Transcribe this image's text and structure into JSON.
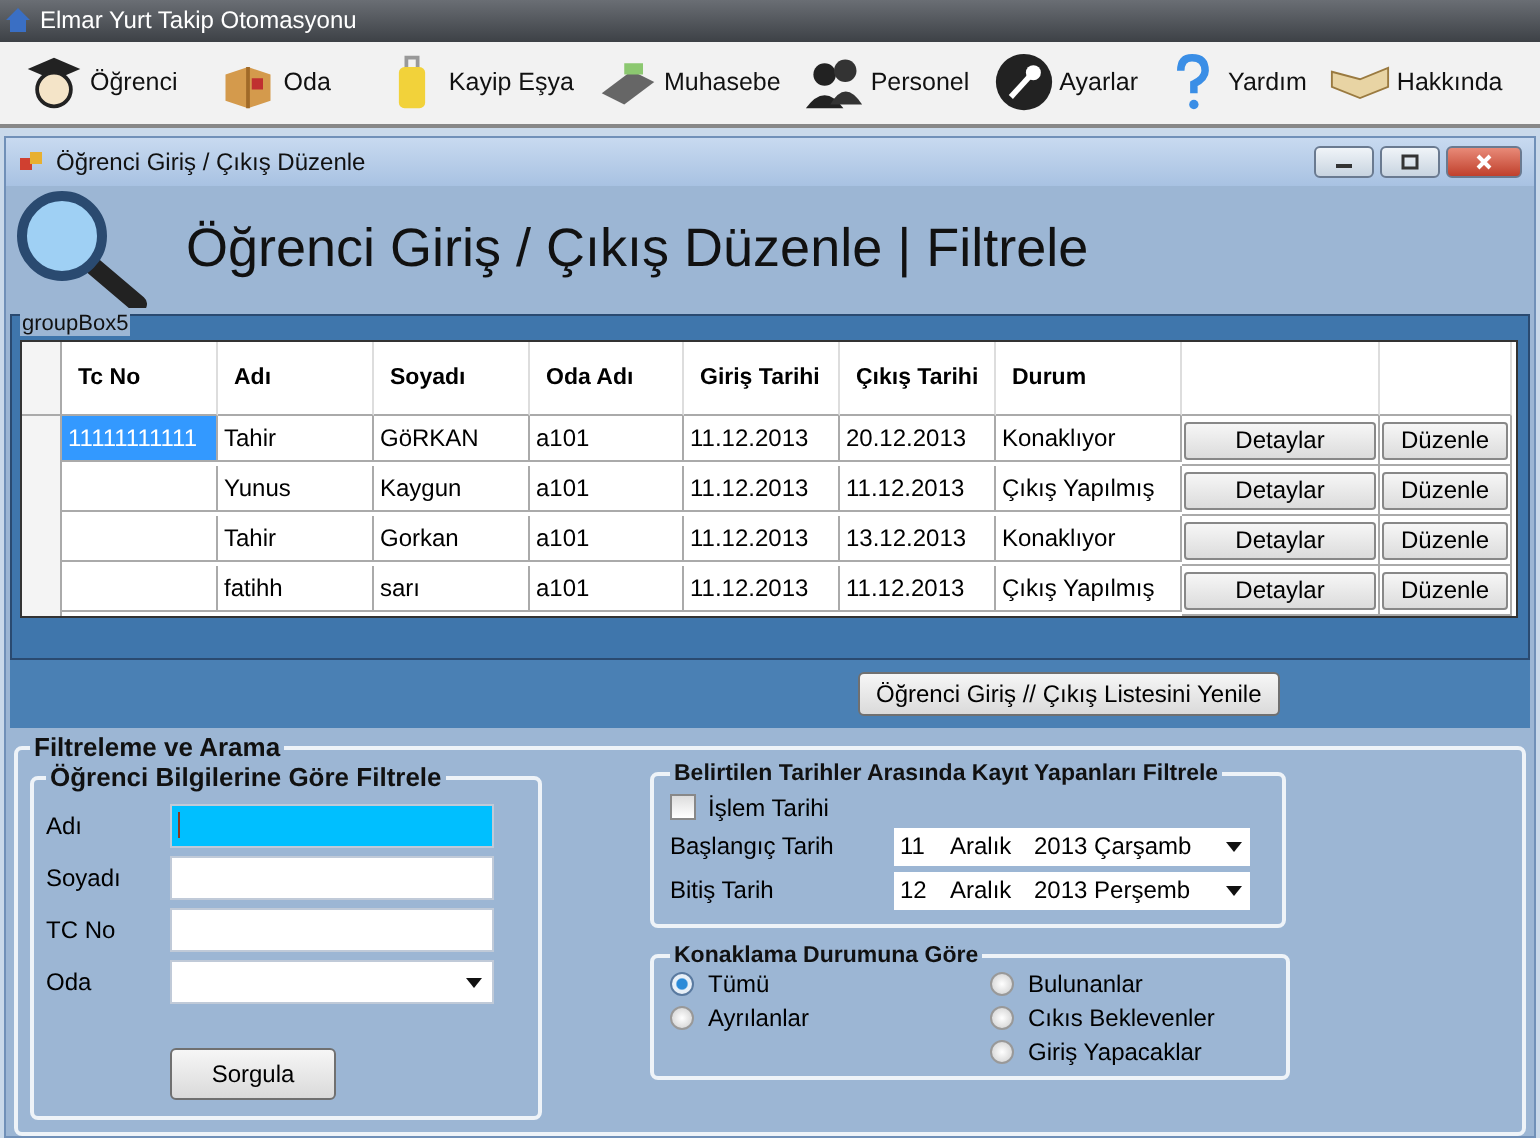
{
  "app_title": "Elmar Yurt Takip Otomasyonu",
  "toolbar": [
    {
      "label": "Öğrenci"
    },
    {
      "label": "Oda"
    },
    {
      "label": "Kayip Eşya"
    },
    {
      "label": "Muhasebe"
    },
    {
      "label": "Personel"
    },
    {
      "label": "Ayarlar"
    },
    {
      "label": "Yardım"
    },
    {
      "label": "Hakkında"
    }
  ],
  "child_window": {
    "title": "Öğrenci Giriş / Çıkış Düzenle"
  },
  "heading": "Öğrenci Giriş / Çıkış Düzenle | Filtrele",
  "grid": {
    "group_title": "groupBox5",
    "columns": [
      "Tc No",
      "Adı",
      "Soyadı",
      "Oda Adı",
      "Giriş Tarihi",
      "Çıkış Tarihi",
      "Durum"
    ],
    "rows": [
      {
        "cells": [
          "11111111111",
          "Tahir",
          "GöRKAN",
          "a101",
          "11.12.2013",
          "20.12.2013",
          "Konaklıyor"
        ],
        "selected": true,
        "buttons": [
          "Detaylar",
          "Düzenle"
        ]
      },
      {
        "cells": [
          "",
          "Yunus",
          "Kaygun",
          "a101",
          "11.12.2013",
          "11.12.2013",
          "Çıkış Yapılmış"
        ],
        "selected": false,
        "buttons": [
          "Detaylar",
          "Düzenle"
        ]
      },
      {
        "cells": [
          "",
          "Tahir",
          "Gorkan",
          "a101",
          "11.12.2013",
          "13.12.2013",
          "Konaklıyor"
        ],
        "selected": false,
        "buttons": [
          "Detaylar",
          "Düzenle"
        ]
      },
      {
        "cells": [
          "",
          "fatihh",
          "sarı",
          "a101",
          "11.12.2013",
          "11.12.2013",
          "Çıkış Yapılmış"
        ],
        "selected": false,
        "buttons": [
          "Detaylar",
          "Düzenle"
        ]
      }
    ]
  },
  "refresh_button": "Öğrenci Giriş // Çıkış Listesini Yenile",
  "filter": {
    "title": "Filtreleme ve Arama",
    "student_group": {
      "title": "Öğrenci Bilgilerine Göre Filtrele",
      "fields": [
        {
          "label": "Adı",
          "kind": "text",
          "focused": true
        },
        {
          "label": "Soyadı",
          "kind": "text",
          "focused": false
        },
        {
          "label": "TC No",
          "kind": "text",
          "focused": false
        },
        {
          "label": "Oda",
          "kind": "combo",
          "focused": false
        }
      ],
      "button": "Sorgula"
    },
    "date_group": {
      "title": "Belirtilen Tarihler Arasında Kayıt Yapanları Filtrele",
      "checkbox": {
        "label": "İşlem Tarihi",
        "checked": false
      },
      "dates": [
        {
          "label": "Başlangıç Tarih",
          "day": "11",
          "month": "Aralık",
          "rest": "2013 Çarşamb"
        },
        {
          "label": "Bitiş Tarih",
          "day": "12",
          "month": "Aralık",
          "rest": "2013 Perşemb"
        }
      ]
    },
    "stay_group": {
      "title": "Konaklama Durumuna Göre",
      "options": [
        {
          "label": "Tümü",
          "selected": true
        },
        {
          "label": "Bulunanlar",
          "selected": false
        },
        {
          "label": "Ayrılanlar",
          "selected": false
        },
        {
          "label": "Cıkıs Beklevenler",
          "selected": false
        },
        {
          "label": "Giriş Yapacaklar",
          "selected": false
        }
      ]
    }
  }
}
